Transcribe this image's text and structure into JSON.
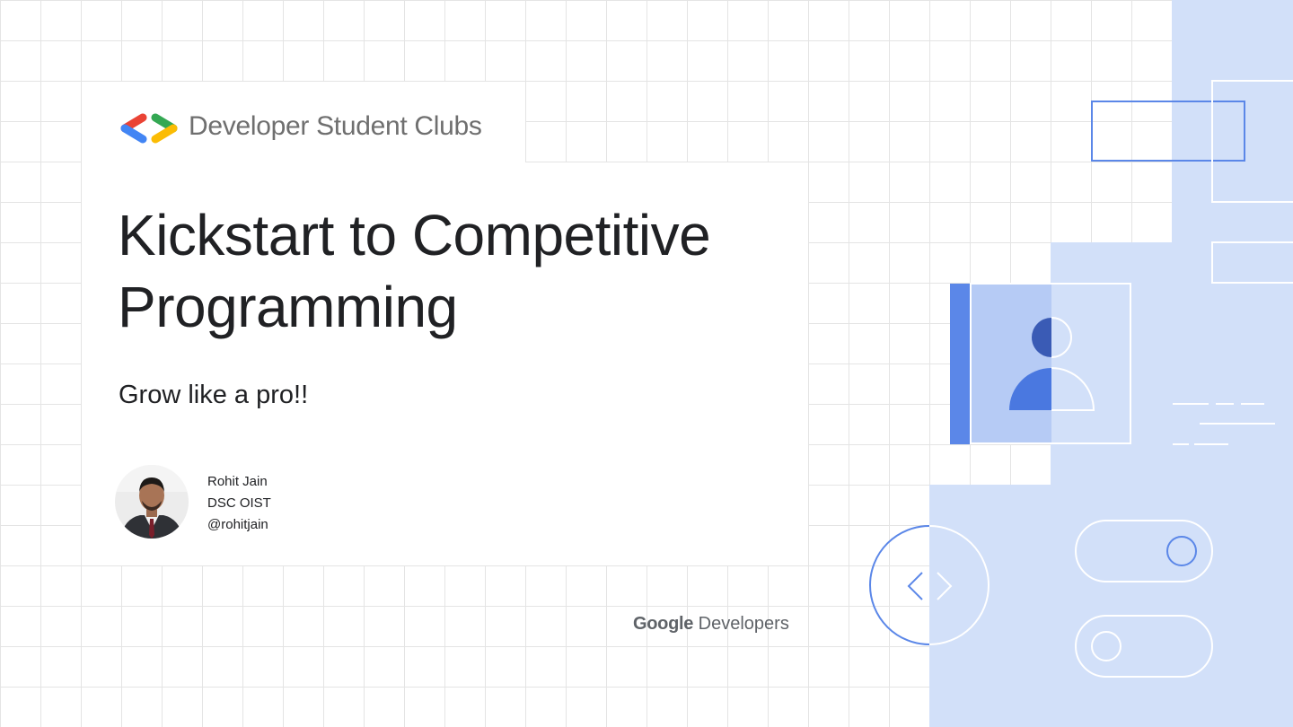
{
  "header": {
    "brand": "Developer Student Clubs",
    "logo_icon": "dsc-brackets-logo"
  },
  "slide": {
    "title_line1": "Kickstart to Competitive",
    "title_line2": "Programming",
    "subtitle": "Grow like a pro!!"
  },
  "author": {
    "name": "Rohit Jain",
    "club": "DSC OIST",
    "handle": "@rohitjain"
  },
  "footer": {
    "google_word": "Google",
    "developers_word": "Developers"
  },
  "colors": {
    "blue": "#4285f4",
    "red": "#ea4335",
    "yellow": "#fbbc04",
    "green": "#34a853",
    "panel_light": "#d2e0f9",
    "accent_blue": "#5b87e8"
  }
}
